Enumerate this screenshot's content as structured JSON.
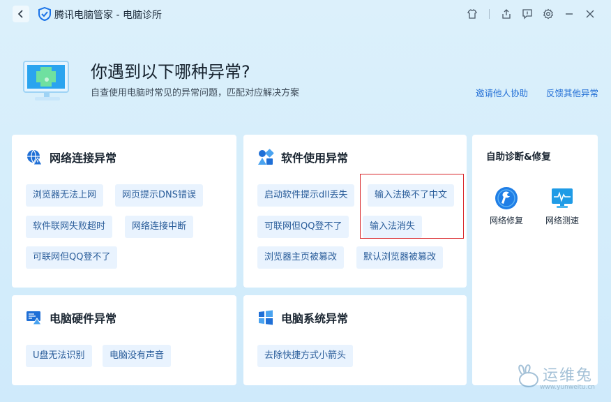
{
  "window": {
    "title": "腾讯电脑管家 - 电脑诊所",
    "title_icons": [
      "shirt-icon",
      "share-icon",
      "feedback-icon",
      "settings-icon",
      "minimize-icon",
      "close-icon"
    ]
  },
  "header": {
    "title": "你遇到以下哪种异常?",
    "subtitle": "自查使用电脑时常见的异常问题，匹配对应解决方案",
    "links": [
      "邀请他人协助",
      "反馈其他异常"
    ]
  },
  "cards": {
    "network": {
      "title": "网络连接异常",
      "items": [
        "浏览器无法上网",
        "网页提示DNS错误",
        "软件联网失败超时",
        "网络连接中断",
        "可联网但QQ登不了"
      ]
    },
    "software": {
      "title": "软件使用异常",
      "items": [
        "启动软件提示dll丢失",
        "输入法换不了中文",
        "可联网但QQ登不了",
        "输入法消失",
        "浏览器主页被篡改",
        "默认浏览器被篡改"
      ]
    },
    "hardware": {
      "title": "电脑硬件异常",
      "items": [
        "U盘无法识别",
        "电脑没有声音"
      ]
    },
    "system": {
      "title": "电脑系统异常",
      "items": [
        "去除快捷方式小箭头"
      ]
    }
  },
  "side": {
    "title": "自助诊断&修复",
    "tools": [
      "网络修复",
      "网络测速"
    ]
  },
  "watermark": {
    "text": "运维兔",
    "url": "www.yunweitu.cn"
  },
  "colors": {
    "accent": "#2470d6",
    "chip_bg": "#e9f3fe",
    "highlight": "#d9262a"
  }
}
